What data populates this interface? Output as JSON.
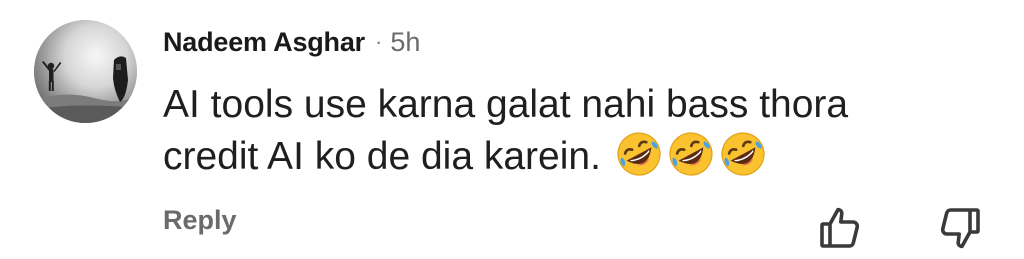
{
  "comment": {
    "author": "Nadeem Asghar",
    "separator": "·",
    "timestamp": "5h",
    "text": "AI tools use karna galat nahi bass thora credit AI ko de dia karein.",
    "emojis": [
      "rolling-on-floor-laughing-emoji",
      "rolling-on-floor-laughing-emoji",
      "rolling-on-floor-laughing-emoji"
    ],
    "reply_label": "Reply"
  },
  "icons": {
    "like": "thumbs-up-icon",
    "dislike": "thumbs-down-icon"
  },
  "colors": {
    "author": "#1a1a1a",
    "meta": "#6b6b6b",
    "emoji_face": "#f9c22e"
  }
}
